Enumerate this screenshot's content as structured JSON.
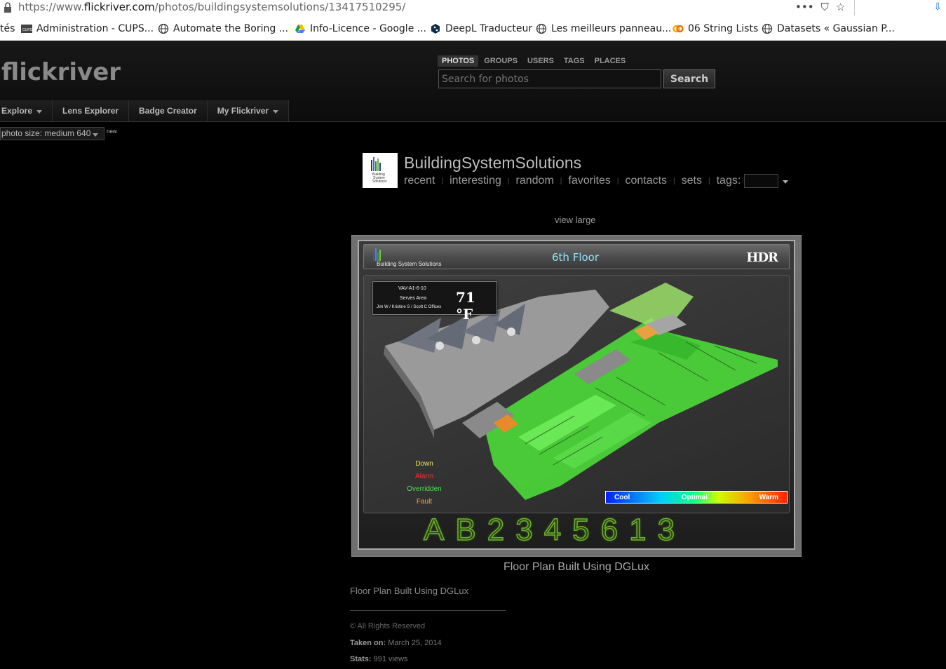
{
  "browser": {
    "url_prefix": "https://www.",
    "url_domain": "flickriver.com",
    "url_path": "/photos/buildingsystemsolutions/13417510295/",
    "actions": [
      "•••",
      "⛉",
      "☆"
    ],
    "bookmarks": [
      {
        "label": "tés",
        "icon": "none"
      },
      {
        "label": "Administration - CUPS...",
        "icon": "cups-icon"
      },
      {
        "label": "Automate the Boring ...",
        "icon": "globe-icon"
      },
      {
        "label": "Info-Licence - Google ...",
        "icon": "google-drive-icon"
      },
      {
        "label": "DeepL Traducteur",
        "icon": "deepl-icon"
      },
      {
        "label": "Les meilleurs panneau...",
        "icon": "globe-icon"
      },
      {
        "label": "06 String Lists",
        "icon": "colab-icon"
      },
      {
        "label": "Datasets « Gaussian P...",
        "icon": "globe-icon"
      }
    ]
  },
  "header": {
    "logo": "flickriver",
    "search_tabs": [
      "PHOTOS",
      "GROUPS",
      "USERS",
      "TAGS",
      "PLACES"
    ],
    "active_tab": "PHOTOS",
    "search_placeholder": "Search for photos",
    "search_button": "Search"
  },
  "nav": {
    "items": [
      {
        "label": "Explore",
        "dropdown": true
      },
      {
        "label": "Lens Explorer",
        "dropdown": false
      },
      {
        "label": "Badge Creator",
        "dropdown": false
      },
      {
        "label": "My Flickriver",
        "dropdown": true
      }
    ],
    "photo_size": "photo size: medium 640",
    "new_badge": "new"
  },
  "user": {
    "name": "BuildingSystemSolutions",
    "links": [
      "recent",
      "interesting",
      "random",
      "favorites",
      "contacts",
      "sets"
    ],
    "tags_label": "tags:"
  },
  "photo": {
    "view_large": "view large",
    "banner_title": "6th Floor",
    "banner_brand": "Building System Solutions",
    "banner_logo": "HDR",
    "vav_id": "VAV-A1-6-10",
    "vav_serves": "Serves Area",
    "vav_people": "Jim W / Kristine S / Scott C Offices",
    "vav_temp": "71 °F",
    "legend": [
      {
        "label": "Down",
        "color": "#f0e060"
      },
      {
        "label": "Alarm",
        "color": "#ff3030"
      },
      {
        "label": "Overridden",
        "color": "#50e050"
      },
      {
        "label": "Fault",
        "color": "#ffa040"
      }
    ],
    "colorbar": [
      "Cool",
      "Optimal",
      "Warm"
    ],
    "floors": [
      "A",
      "B",
      "2",
      "3",
      "4",
      "5",
      "6",
      "1",
      "3"
    ],
    "caption": "Floor Plan Built Using DGLux"
  },
  "details": {
    "description": "Floor Plan Built Using DGLux",
    "rights": "© All Rights Reserved",
    "taken_label": "Taken on:",
    "taken_value": "March 25, 2014",
    "stats_label": "Stats:",
    "stats_value": "991 views"
  }
}
